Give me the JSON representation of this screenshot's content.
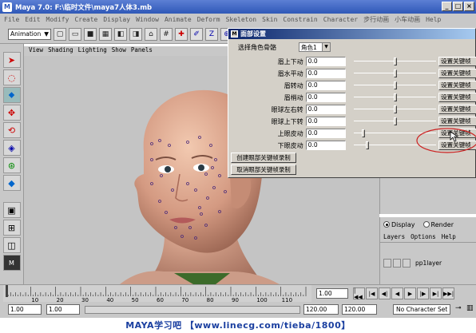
{
  "window": {
    "title": "Maya 7.0: F:\\临时文件\\maya7人体3.mb",
    "buttons": [
      "_",
      "□",
      "×"
    ]
  },
  "menubar": [
    "File",
    "Edit",
    "Modify",
    "Create",
    "Display",
    "Window",
    "Animate",
    "Deform",
    "Skeleton",
    "Skin",
    "Constrain",
    "Character",
    "步行动画",
    "小车动画",
    "Help"
  ],
  "statusline": {
    "menu_set": "Animation"
  },
  "panel_menu": [
    "View",
    "Shading",
    "Lighting",
    "Show",
    "Panels"
  ],
  "dialog": {
    "title": "面部设置",
    "role_label": "选择角色骨骼",
    "role_value": "角色1",
    "rows": [
      {
        "label": "眉上下动",
        "value": "0.0",
        "slider": 0.5,
        "button": "设置关键帧"
      },
      {
        "label": "眉水平动",
        "value": "0.0",
        "slider": 0.5,
        "button": "设置关键帧"
      },
      {
        "label": "眉转动",
        "value": "0.0",
        "slider": 0.5,
        "button": "设置关键帧"
      },
      {
        "label": "眉梢动",
        "value": "0.0",
        "slider": 0.5,
        "button": "设置关键帧"
      },
      {
        "label": "眼球左右转",
        "value": "0.0",
        "slider": 0.5,
        "button": "设置关键帧"
      },
      {
        "label": "眼球上下转",
        "value": "0.0",
        "slider": 0.5,
        "button": "设置关键帧"
      },
      {
        "label": "上眼皮动",
        "value": "0.0",
        "slider": 0.1,
        "button": "设置关键帧"
      },
      {
        "label": "下眼皮动",
        "value": "0.0",
        "slider": 0.15,
        "button": "设置关键帧"
      }
    ],
    "create_button": "创建眼部关键帧录制",
    "cancel_button": "取消眼部关键帧录制"
  },
  "layer_editor": {
    "display_label": "Display",
    "render_label": "Render",
    "menu": [
      "Layers",
      "Options",
      "Help"
    ],
    "layer_name": "pp1layer"
  },
  "timeline": {
    "ticks": [
      "10",
      "20",
      "30",
      "40",
      "50",
      "60",
      "70",
      "80",
      "90",
      "100",
      "110"
    ],
    "current_frame": "1.00",
    "play_buttons": [
      "|◀◀",
      "|◀",
      "◀|",
      "◀",
      "▶",
      "|▶",
      "▶|",
      "▶▶|"
    ]
  },
  "range": {
    "start": "1.00",
    "playback_start": "1.00",
    "playback_end": "120.00",
    "end": "120.00",
    "char_set": "No Character Set"
  },
  "watermark": "MAYA学习吧 【www.linecg.com/tieba/1800】",
  "colors": {
    "title_bar": "#2f58b8",
    "dialog_title": "#0a246a",
    "annotation": "#cc2020",
    "watermark": "#1a3fa0"
  }
}
